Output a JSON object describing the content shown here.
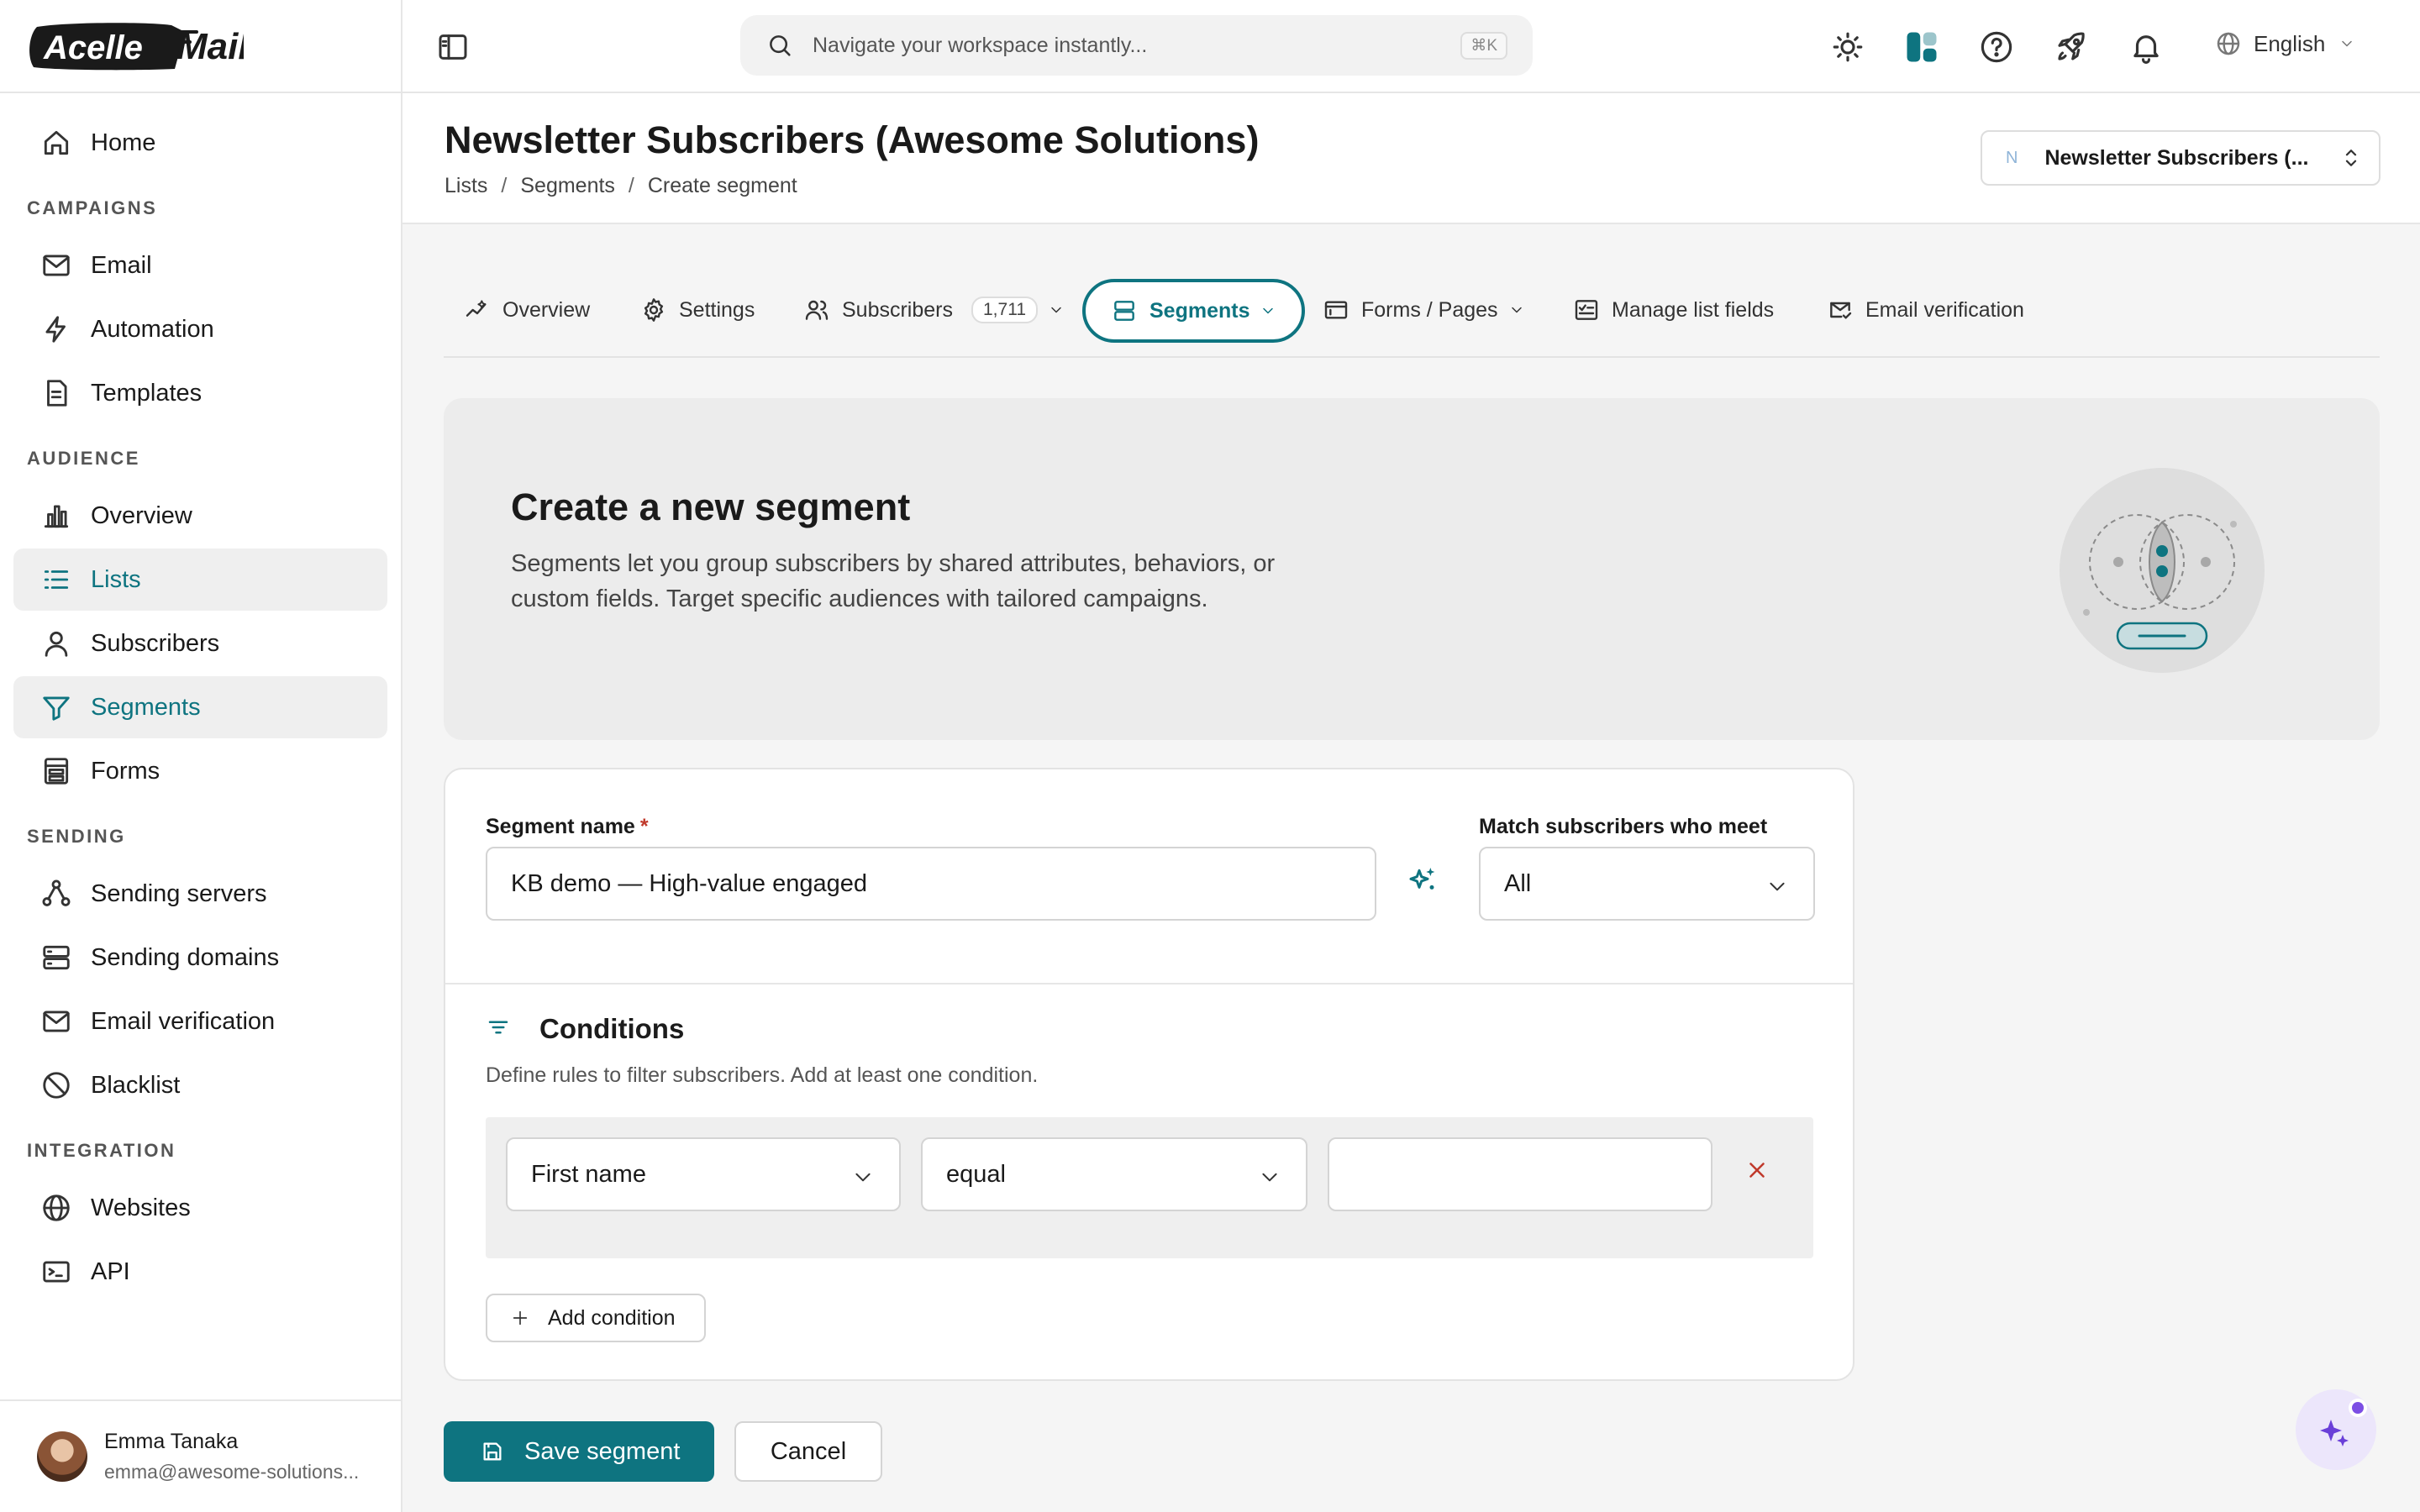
{
  "app": {
    "logo_text": "Acelle Mail"
  },
  "sidebar": {
    "items": [
      {
        "label": "Home",
        "icon": "home-icon"
      },
      {
        "section": "CAMPAIGNS"
      },
      {
        "label": "Email",
        "icon": "mail-icon"
      },
      {
        "label": "Automation",
        "icon": "bolt-icon"
      },
      {
        "label": "Templates",
        "icon": "document-icon"
      },
      {
        "section": "AUDIENCE"
      },
      {
        "label": "Overview",
        "icon": "bar-chart-icon"
      },
      {
        "label": "Lists",
        "icon": "list-icon",
        "active": true
      },
      {
        "label": "Subscribers",
        "icon": "user-icon"
      },
      {
        "label": "Segments",
        "icon": "funnel-icon",
        "active": true
      },
      {
        "label": "Forms",
        "icon": "form-icon"
      },
      {
        "section": "SENDING"
      },
      {
        "label": "Sending servers",
        "icon": "network-icon"
      },
      {
        "label": "Sending domains",
        "icon": "server-icon"
      },
      {
        "label": "Email verification",
        "icon": "mail-icon"
      },
      {
        "label": "Blacklist",
        "icon": "ban-icon"
      },
      {
        "section": "INTEGRATION"
      },
      {
        "label": "Websites",
        "icon": "globe-icon"
      },
      {
        "label": "API",
        "icon": "terminal-icon"
      }
    ],
    "user": {
      "name": "Emma Tanaka",
      "email": "emma@awesome-solutions..."
    }
  },
  "topbar": {
    "search_placeholder": "Navigate your workspace instantly...",
    "shortcut": "⌘K",
    "language": "English"
  },
  "header": {
    "title": "Newsletter Subscribers (Awesome Solutions)",
    "breadcrumb": [
      "Lists",
      "Segments",
      "Create segment"
    ],
    "list_selector": {
      "initial": "N",
      "label": "Newsletter Subscribers (..."
    }
  },
  "tabs": [
    {
      "label": "Overview"
    },
    {
      "label": "Settings"
    },
    {
      "label": "Subscribers",
      "badge": "1,711"
    },
    {
      "label": "Segments",
      "active": true
    },
    {
      "label": "Forms / Pages"
    },
    {
      "label": "Manage list fields"
    },
    {
      "label": "Email verification"
    }
  ],
  "hero": {
    "title": "Create a new segment",
    "description": "Segments let you group subscribers by shared attributes, behaviors, or custom fields. Target specific audiences with tailored campaigns."
  },
  "form": {
    "segment_name_label": "Segment name",
    "required_mark": "*",
    "segment_name_value": "KB demo — High-value engaged",
    "match_label": "Match subscribers who meet",
    "match_value": "All",
    "conditions_title": "Conditions",
    "conditions_desc": "Define rules to filter subscribers. Add at least one condition.",
    "condition": {
      "field": "First name",
      "operator": "equal",
      "value": ""
    },
    "add_condition": "Add condition",
    "save": "Save segment",
    "cancel": "Cancel"
  },
  "colors": {
    "accent": "#0e7480",
    "danger": "#c0392b"
  }
}
